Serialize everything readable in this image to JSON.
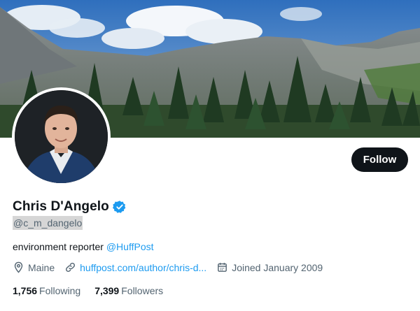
{
  "profile": {
    "display_name": "Chris D'Angelo",
    "handle": "@c_m_dangelo",
    "bio_text": "environment reporter ",
    "bio_mention": "@HuffPost",
    "location": "Maine",
    "website": "huffpost.com/author/chris-d...",
    "joined": "Joined January 2009",
    "following_count": "1,756",
    "following_label": "Following",
    "followers_count": "7,399",
    "followers_label": "Followers",
    "follow_label": "Follow"
  },
  "icons": {
    "verified": "verified-badge-icon",
    "location": "location-pin-icon",
    "link": "link-icon",
    "calendar": "calendar-icon"
  },
  "colors": {
    "accent": "#1d9bf0",
    "text": "#0f1419",
    "muted": "#536471",
    "button": "#0f1419"
  }
}
